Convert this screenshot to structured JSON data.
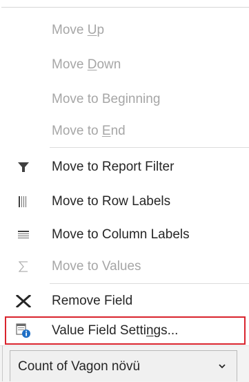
{
  "menu": {
    "items": [
      {
        "pre": "Move ",
        "acc": "U",
        "post": "p",
        "disabled": true,
        "icon": ""
      },
      {
        "pre": "Move ",
        "acc": "D",
        "post": "own",
        "disabled": true,
        "icon": ""
      },
      {
        "pre": "Move to Be",
        "acc": "g",
        "post": "inning",
        "disabled": true,
        "icon": ""
      },
      {
        "pre": "Move to ",
        "acc": "E",
        "post": "nd",
        "disabled": true,
        "icon": ""
      },
      {
        "pre": "Move to Report Filter",
        "acc": "",
        "post": "",
        "disabled": false,
        "icon": "filter-icon"
      },
      {
        "pre": "Move to Row Labels",
        "acc": "",
        "post": "",
        "disabled": false,
        "icon": "row-labels-icon"
      },
      {
        "pre": "Move to Column Labels",
        "acc": "",
        "post": "",
        "disabled": false,
        "icon": "column-labels-icon"
      },
      {
        "pre": "Move to Values",
        "acc": "",
        "post": "",
        "disabled": true,
        "icon": "sigma-icon"
      },
      {
        "pre": "Remove Field",
        "acc": "",
        "post": "",
        "disabled": false,
        "icon": "remove-x-icon"
      },
      {
        "pre": "Value Field Setti",
        "acc": "n",
        "post": "gs...",
        "disabled": false,
        "icon": "value-field-settings-icon"
      }
    ]
  },
  "field_chip": {
    "label": "Count of Vagon növü",
    "icon": "chevron-down-icon"
  },
  "colors": {
    "disabled_text": "#a6a6a6",
    "text": "#262626",
    "highlight_border": "#d9232d",
    "info_blue": "#1e6fc5"
  }
}
